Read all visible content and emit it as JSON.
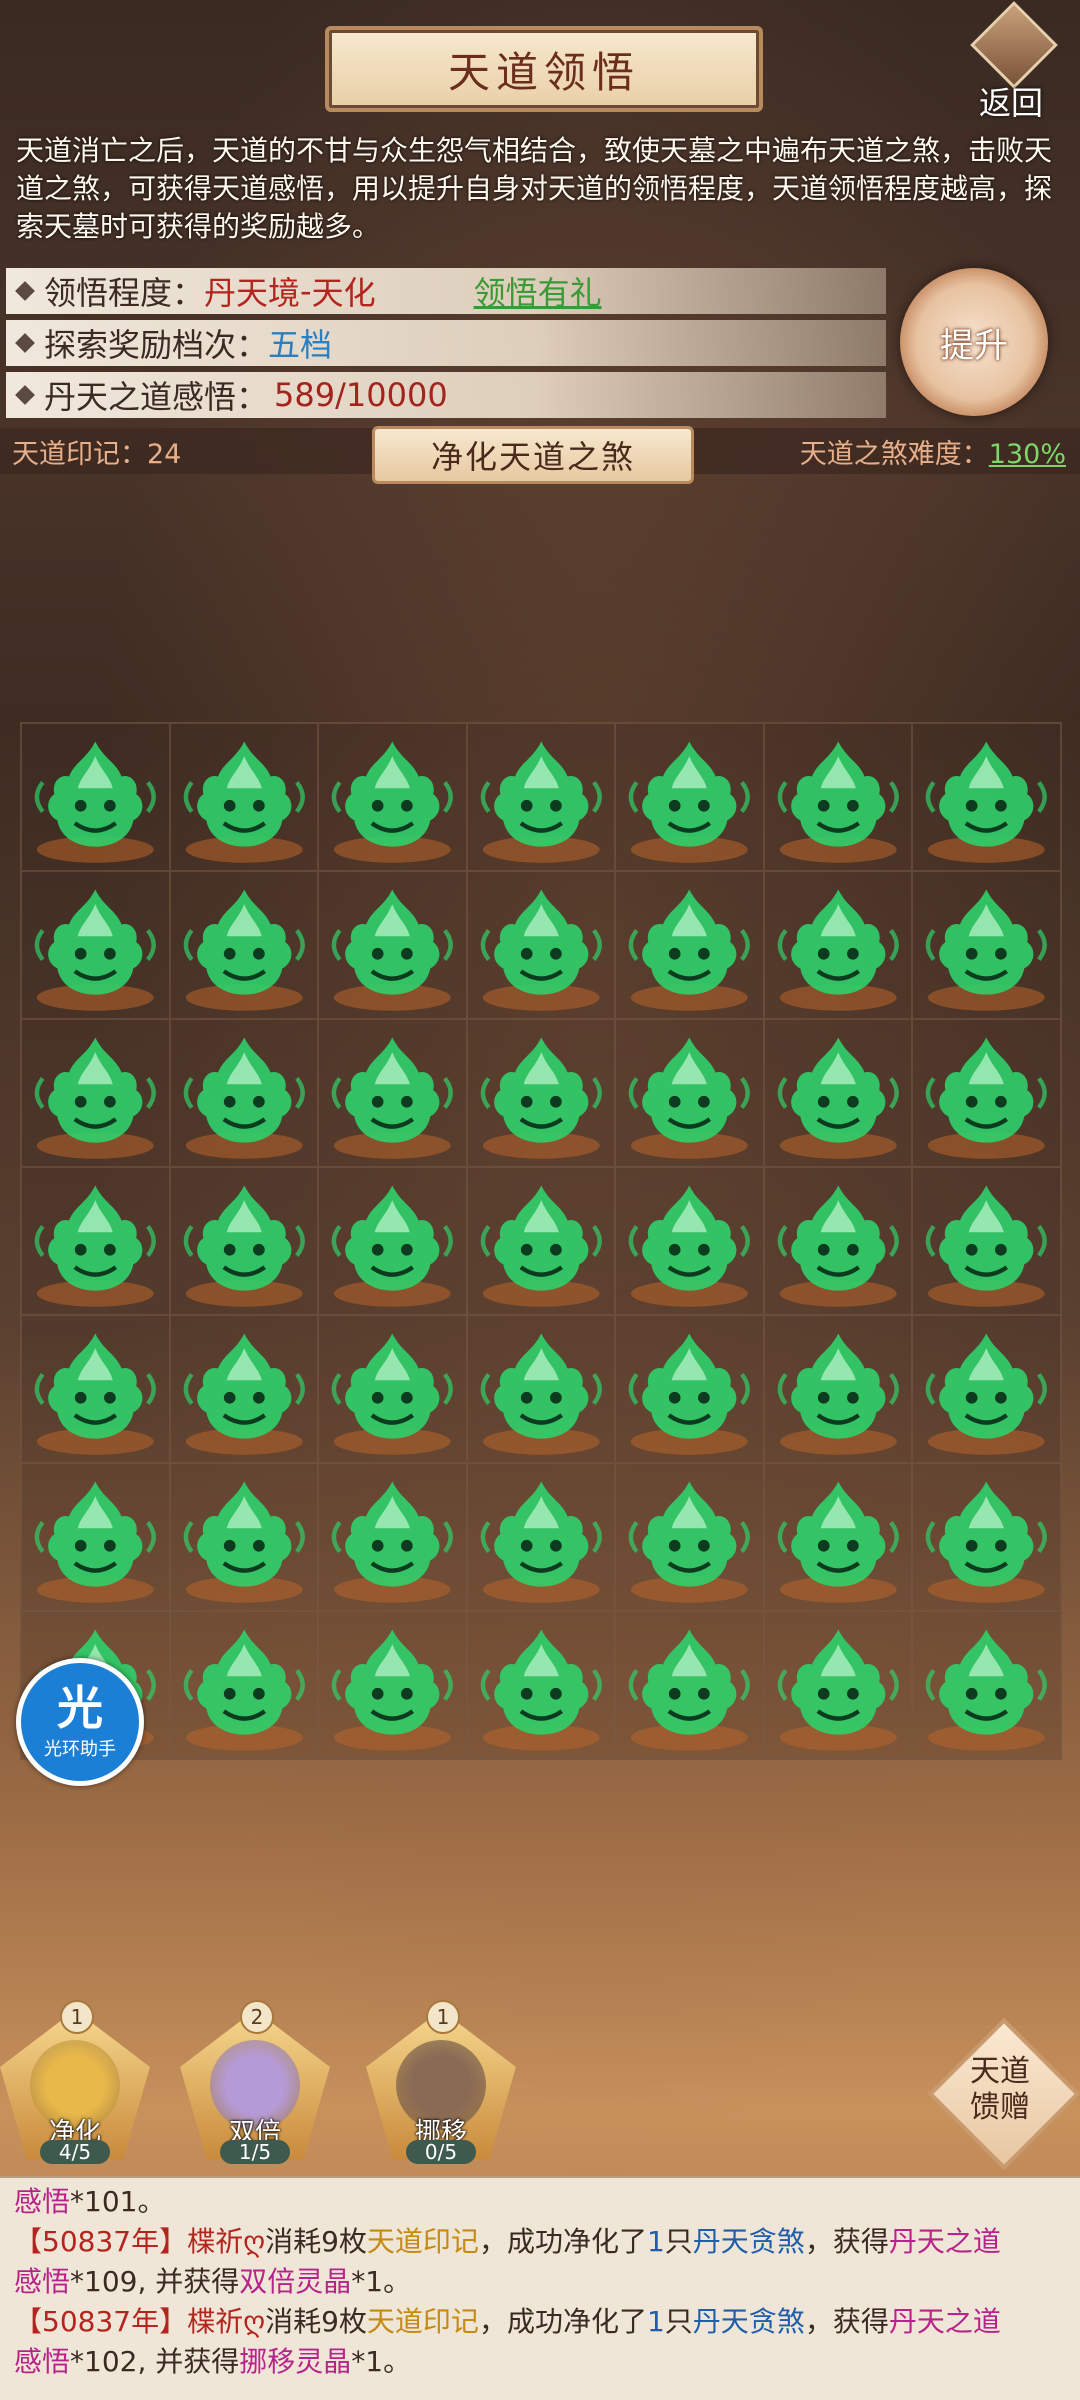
{
  "header": {
    "title": "天道领悟",
    "back_label": "返回"
  },
  "description": "天道消亡之后，天道的不甘与众生怨气相结合，致使天墓之中遍布天道之煞，击败天道之煞，可获得天道感悟，用以提升自身对天道的领悟程度，天道领悟程度越高，探索天墓时可获得的奖励越多。",
  "info": {
    "comprehension_label": "领悟程度：",
    "comprehension_value_a": "丹天境",
    "comprehension_sep": "-",
    "comprehension_value_b": "天化",
    "gift_link": "领悟有礼",
    "reward_label": "探索奖励档次：",
    "reward_value": "五档",
    "insight_label": "丹天之道感悟：",
    "insight_value": "589/10000",
    "upgrade_label": "提升"
  },
  "strip": {
    "marks_label": "天道印记：",
    "marks_value": "24",
    "purify_title": "净化天道之煞",
    "difficulty_label": "天道之煞难度：",
    "difficulty_value": "130%"
  },
  "grid": {
    "rows": 7,
    "cols": 7,
    "monster_icon": "green-demon-head-icon",
    "monster_color": "#2fd06a"
  },
  "helper": {
    "glyph": "光",
    "label": "光环助手"
  },
  "skills": [
    {
      "name": "净化",
      "badge": "1",
      "count": "4/5",
      "orb_color": "#e9b84a"
    },
    {
      "name": "双倍",
      "badge": "2",
      "count": "1/5",
      "orb_color": "#b59ad8"
    },
    {
      "name": "挪移",
      "badge": "1",
      "count": "0/5",
      "orb_color": "#8a6a55"
    }
  ],
  "gift": {
    "label_line1": "天道",
    "label_line2": "馈赠"
  },
  "log": {
    "first": {
      "a": "感悟",
      "b": "*101。"
    },
    "entries": [
      {
        "year": "【50837年】",
        "player": "楪祈ღ",
        "consume": "消耗9枚",
        "item": "天道印记",
        "purified": "，成功净化了",
        "count": "1",
        "unit": "只",
        "monster": "丹天贪煞",
        "get": "，获得",
        "reward_a": "丹天之道",
        "reward_b": "感悟",
        "reward_amount": "*109",
        "extra": ", 并获得",
        "bonus": "双倍灵晶",
        "bonus_amount": "*1。"
      },
      {
        "year": "【50837年】",
        "player": "楪祈ღ",
        "consume": "消耗9枚",
        "item": "天道印记",
        "purified": "，成功净化了",
        "count": "1",
        "unit": "只",
        "monster": "丹天贪煞",
        "get": "，获得",
        "reward_a": "丹天之道",
        "reward_b": "感悟",
        "reward_amount": "*102",
        "extra": ", 并获得",
        "bonus": "挪移灵晶",
        "bonus_amount": "*1。"
      }
    ]
  }
}
